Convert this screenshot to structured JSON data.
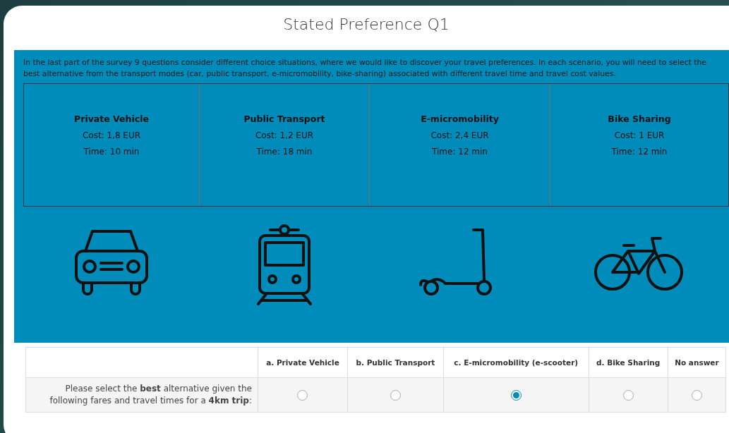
{
  "title": "Stated Preference Q1",
  "intro": "In the last part of the survey 9 questions consider different choice situations, where we would like to discover your travel preferences. In each scenario, you will need to select the best alternative from the transport modes (car, public transport, e-micromobility, bike-sharing) associated with different travel time and travel cost values.",
  "alternatives": [
    {
      "name": "Private Vehicle",
      "cost": "Cost: 1,8 EUR",
      "time": "Time: 10 min",
      "kind": "car"
    },
    {
      "name": "Public Transport",
      "cost": "Cost: 1,2 EUR",
      "time": "Time: 18 min",
      "kind": "train"
    },
    {
      "name": "E-micromobility",
      "cost": "Cost: 2,4 EUR",
      "time": "Time: 12 min",
      "kind": "scooter"
    },
    {
      "name": "Bike Sharing",
      "cost": "Cost: 1 EUR",
      "time": "Time: 12 min",
      "kind": "bike"
    }
  ],
  "question": {
    "text": "Please select the **best** alternative given the following fares and travel times for a **4km trip**:",
    "options": [
      {
        "label": "a. Private Vehicle",
        "selected": false
      },
      {
        "label": "b. Public Transport",
        "selected": false
      },
      {
        "label": "c. E-micromobility (e-scooter)",
        "selected": true
      },
      {
        "label": "d. Bike Sharing",
        "selected": false
      },
      {
        "label": "No answer",
        "selected": false
      }
    ]
  }
}
